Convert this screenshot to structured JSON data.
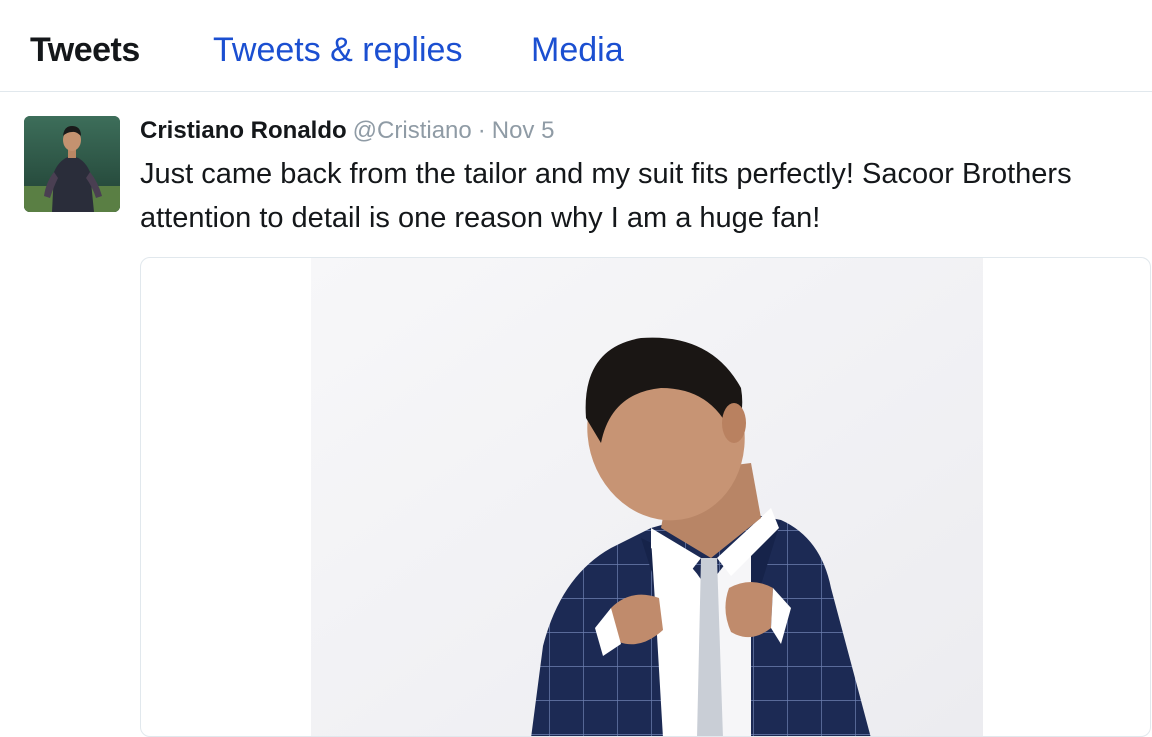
{
  "tabs": [
    {
      "label": "Tweets",
      "active": true
    },
    {
      "label": "Tweets & replies",
      "active": false
    },
    {
      "label": "Media",
      "active": false
    }
  ],
  "tweet": {
    "author_name": "Cristiano Ronaldo",
    "handle": "@Cristiano",
    "separator": "·",
    "date": "Nov 5",
    "text": "Just came back from the tailor and my suit fits perfectly! Sacoor Brothers attention to detail is one reason why I am a huge fan!"
  },
  "colors": {
    "link": "#1b4fd1",
    "muted": "#8f9ba5",
    "text": "#14171a",
    "border": "#e1e8ed"
  }
}
